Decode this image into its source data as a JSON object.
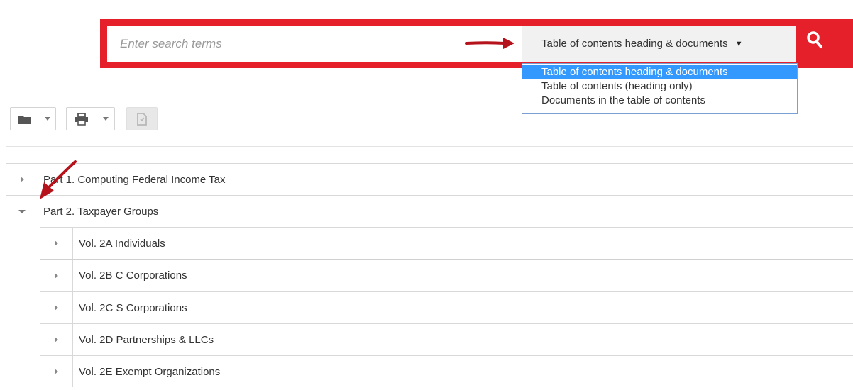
{
  "search": {
    "placeholder": "Enter search terms",
    "scope_selected": "Table of contents heading & documents",
    "scope_caret": "▼",
    "button_icon": "search-icon"
  },
  "scope_options": [
    "Table of contents heading & documents",
    "Table of contents (heading only)",
    "Documents in the table of contents"
  ],
  "toolbar": {
    "folder_icon": "folder-icon",
    "print_icon": "print-icon",
    "document_icon": "document-icon"
  },
  "tree": {
    "parts": [
      {
        "label": "Part 1. Computing Federal Income Tax",
        "expanded": false
      },
      {
        "label": "Part 2. Taxpayer Groups",
        "expanded": true
      }
    ],
    "volumes": [
      "Vol. 2A Individuals",
      "Vol. 2B C Corporations",
      "Vol. 2C S Corporations",
      "Vol. 2D Partnerships & LLCs",
      "Vol. 2E Exempt Organizations"
    ]
  },
  "colors": {
    "highlight": "#e5202b",
    "selected_option": "#3399ff",
    "annotation_arrow": "#b5121b"
  }
}
